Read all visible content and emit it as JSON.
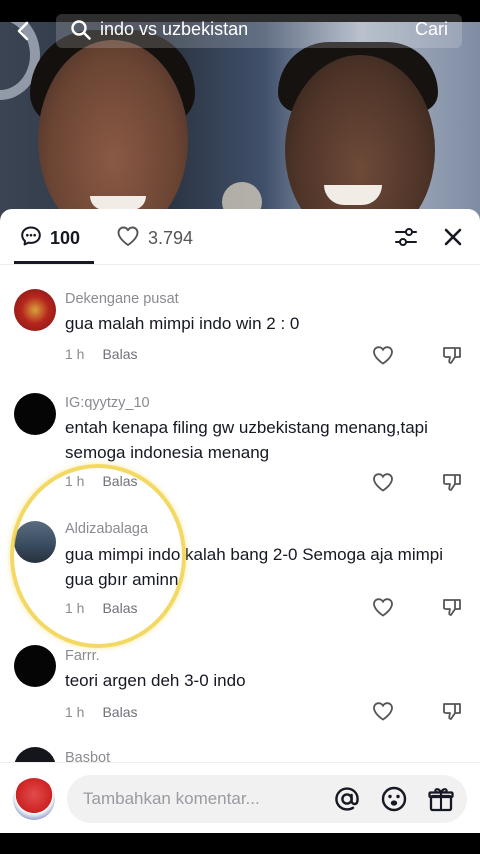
{
  "search": {
    "query": "indo vs uzbekistan",
    "button_label": "Cari"
  },
  "sheet": {
    "comment_count": "100",
    "like_count": "3.794"
  },
  "comments": [
    {
      "username": "Dekengane pusat",
      "text": "gua malah mimpi indo win 2 : 0",
      "time": "1 h",
      "reply_label": "Balas"
    },
    {
      "username": "IG:qyytzy_10",
      "text": "entah kenapa filing gw uzbekistang menang,tapi semoga indonesia menang",
      "time": "1 h",
      "reply_label": "Balas"
    },
    {
      "username": "Aldizabalaga",
      "text": "gua mimpi indo kalah bang 2-0 Semoga aja mimpi gua gbır aminn",
      "time": "1 h",
      "reply_label": "Balas"
    },
    {
      "username": "Farrr.",
      "text": "teori argen deh 3-0 indo",
      "time": "1 h",
      "reply_label": "Balas"
    },
    {
      "username": "Basbot",
      "text": "",
      "time": "",
      "reply_label": ""
    }
  ],
  "input": {
    "placeholder": "Tambahkan komentar..."
  },
  "colors": {
    "highlight": "#f1d34a",
    "text_primary": "#161823",
    "text_secondary": "#8a8b91"
  }
}
